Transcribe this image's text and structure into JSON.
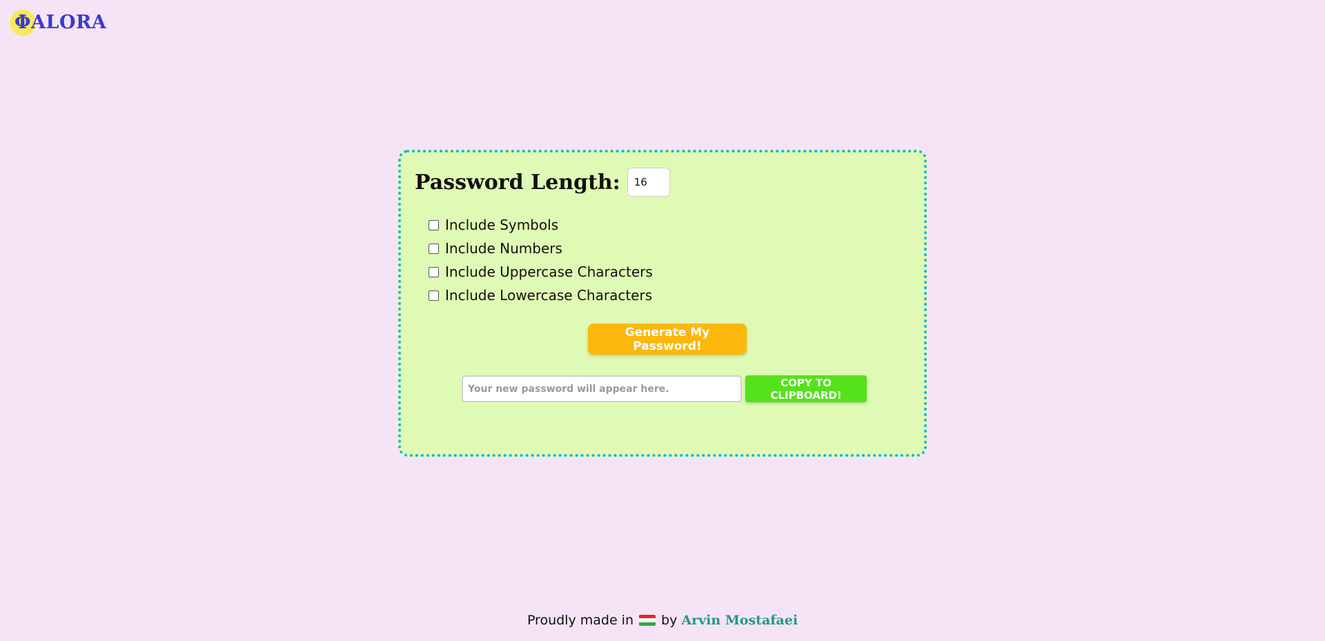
{
  "logo": {
    "text": "ΦALORA",
    "accent_color": "#f7e95a",
    "text_color": "#3a3ad0"
  },
  "generator": {
    "length_label": "Password Length:",
    "length_value": "16",
    "options": [
      {
        "label": "Include Symbols",
        "checked": false
      },
      {
        "label": "Include Numbers",
        "checked": false
      },
      {
        "label": "Include Uppercase Characters",
        "checked": false
      },
      {
        "label": "Include Lowercase Characters",
        "checked": false
      }
    ],
    "generate_label": "Generate My Password!",
    "output_placeholder": "Your new password will appear here.",
    "output_value": "",
    "copy_label": "COPY TO CLIPBOARD!"
  },
  "footer": {
    "prefix": "Proudly made in",
    "flag_colors": [
      "#e8262b",
      "#ffffff",
      "#2ea84a"
    ],
    "middle": "by",
    "author": "Arvin Mostafaei"
  },
  "colors": {
    "background": "#f5e4f5",
    "card": "#dffab4",
    "card_border": "#14b4d8",
    "generate_button": "#fbb80a",
    "copy_button": "#55e21c",
    "author_link": "#1f9a84"
  }
}
